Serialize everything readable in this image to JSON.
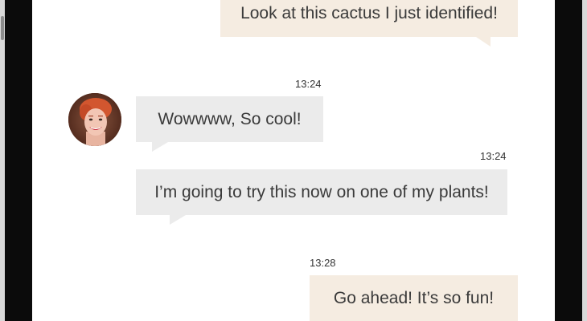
{
  "chat": {
    "messages": [
      {
        "direction": "outgoing",
        "text": "Look at this cactus I just identified!"
      },
      {
        "direction": "incoming",
        "time": "13:24",
        "text": "Wowwww, So cool!"
      },
      {
        "direction": "incoming",
        "time": "13:24",
        "text": "I’m going to try this now on one of my plants!"
      },
      {
        "direction": "outgoing",
        "time": "13:28",
        "text": "Go ahead! It’s so fun!"
      }
    ]
  },
  "colors": {
    "outgoing_bubble": "#f5ece1",
    "incoming_bubble": "#ebebeb",
    "text": "#3a3a3a",
    "device_frame": "#0b0b0b"
  },
  "icons": {
    "avatar": "user-avatar-photo"
  }
}
